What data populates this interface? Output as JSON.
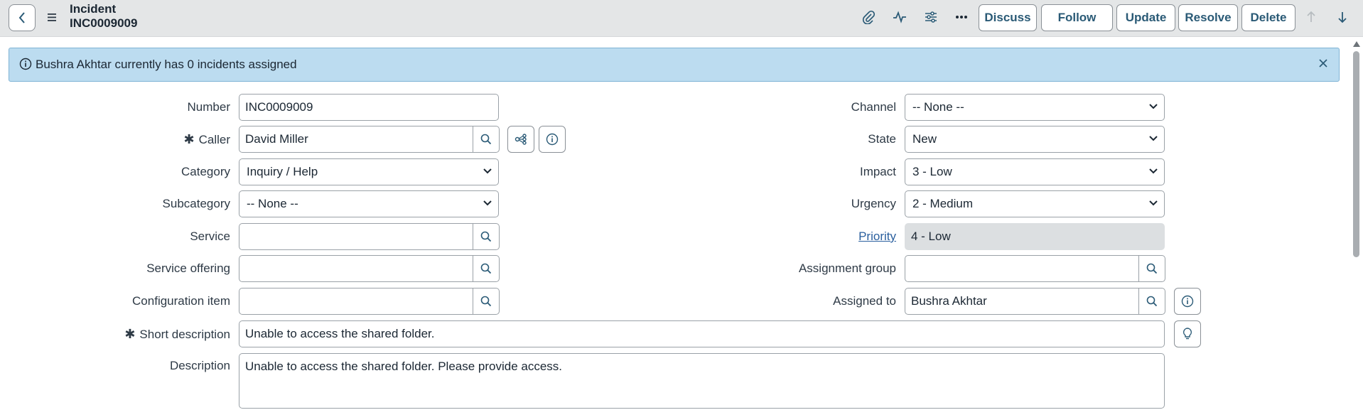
{
  "header": {
    "record_type": "Incident",
    "record_number": "INC0009009",
    "buttons": {
      "discuss": "Discuss",
      "follow": "Follow",
      "update": "Update",
      "resolve": "Resolve",
      "delete": "Delete"
    },
    "icons": [
      "back-icon",
      "menu-icon",
      "paperclip-icon",
      "activity-icon",
      "settings-sliders-icon",
      "more-icon",
      "arrow-up-icon",
      "arrow-down-icon"
    ]
  },
  "banner": {
    "text": "Bushra Akhtar currently has 0 incidents assigned"
  },
  "form": {
    "number": {
      "label": "Number",
      "value": "INC0009009"
    },
    "caller": {
      "label": "Caller",
      "value": "David Miller",
      "required": true
    },
    "category": {
      "label": "Category",
      "value": "Inquiry / Help"
    },
    "subcategory": {
      "label": "Subcategory",
      "value": "-- None --"
    },
    "service": {
      "label": "Service",
      "value": ""
    },
    "service_offering": {
      "label": "Service offering",
      "value": ""
    },
    "configuration_item": {
      "label": "Configuration item",
      "value": ""
    },
    "short_description": {
      "label": "Short description",
      "value": "Unable to access the shared folder.",
      "required": true
    },
    "description": {
      "label": "Description",
      "value": "Unable to access the shared folder. Please provide access."
    },
    "channel": {
      "label": "Channel",
      "value": "-- None --"
    },
    "state": {
      "label": "State",
      "value": "New"
    },
    "impact": {
      "label": "Impact",
      "value": "3 - Low"
    },
    "urgency": {
      "label": "Urgency",
      "value": "2 - Medium"
    },
    "priority": {
      "label": "Priority",
      "value": "4 - Low"
    },
    "assignment_group": {
      "label": "Assignment group",
      "value": ""
    },
    "assigned_to": {
      "label": "Assigned to",
      "value": "Bushra Akhtar"
    }
  },
  "colors": {
    "header_bg": "#e4e6e7",
    "banner_bg": "#bcdcf0",
    "button_text": "#2a5a76",
    "link": "#2a5f9e"
  }
}
